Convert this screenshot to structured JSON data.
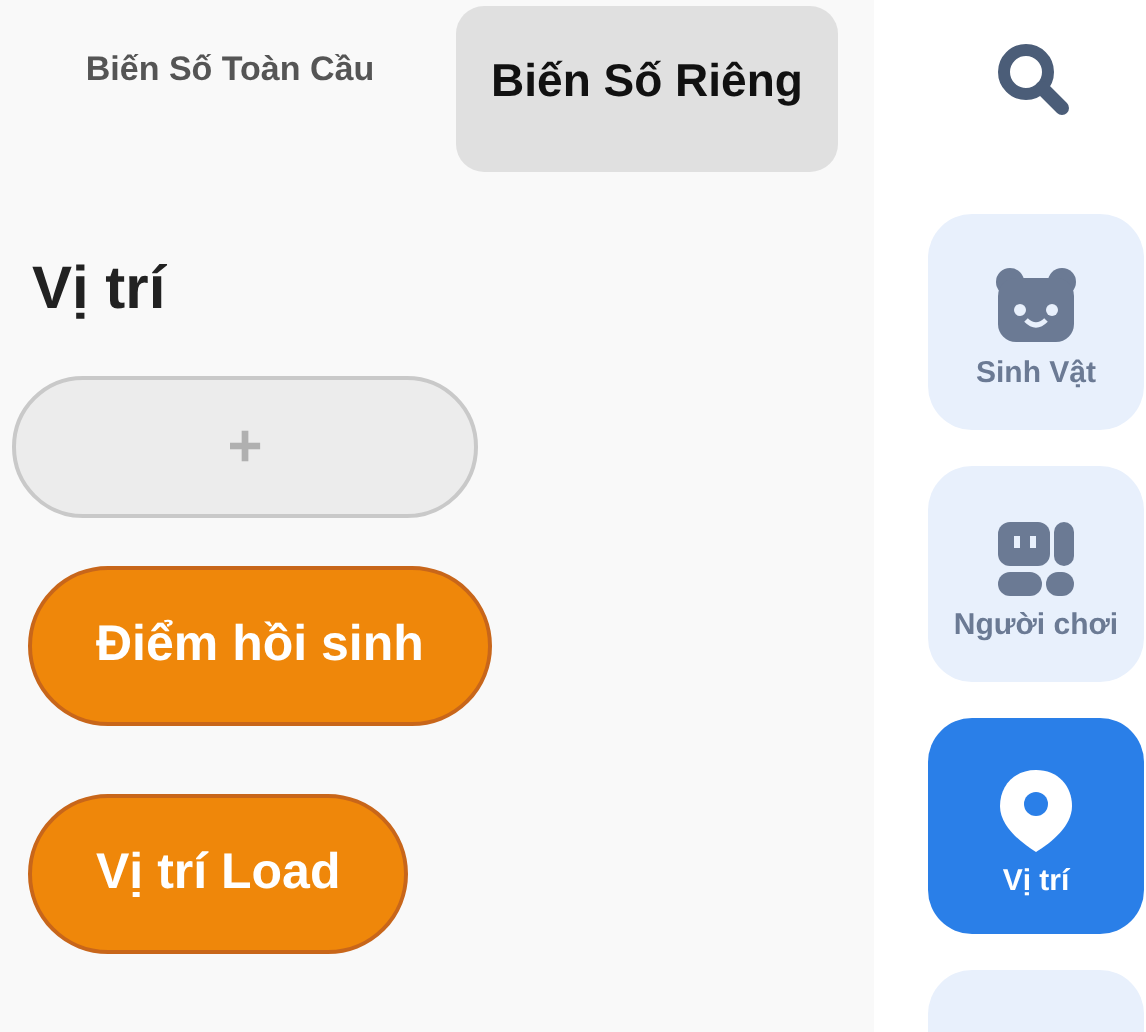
{
  "tabs": [
    {
      "label": "Biến Số Toàn Cầu",
      "selected": false
    },
    {
      "label": "Biến Số Riêng",
      "selected": true
    }
  ],
  "section": {
    "title": "Vị trí",
    "add_button": "+",
    "items": [
      {
        "label": "Điểm hồi sinh"
      },
      {
        "label": "Vị trí Load"
      }
    ]
  },
  "sidebar": {
    "items": [
      {
        "kind": "creature",
        "label": "Sinh Vật",
        "selected": false
      },
      {
        "kind": "player",
        "label": "Người chơi",
        "selected": false
      },
      {
        "kind": "location",
        "label": "Vị trí",
        "selected": true
      },
      {
        "kind": "blank",
        "selected": false
      }
    ]
  }
}
